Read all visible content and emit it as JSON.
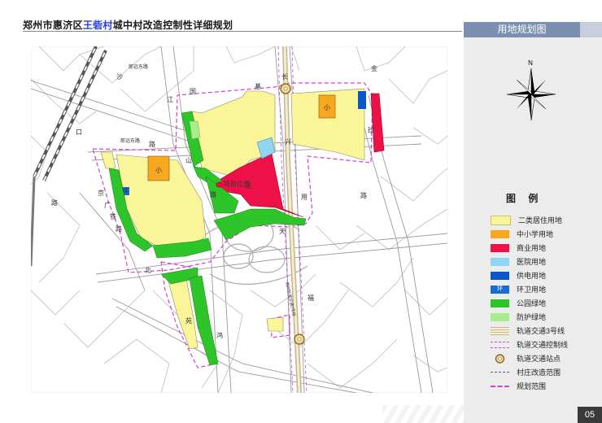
{
  "header": {
    "title_prefix": "郑州市惠济区",
    "title_highlight": "王砦村",
    "title_suffix": "城中村改造控制性详细规划",
    "panel_tab": "用地规划图",
    "page_number": "05"
  },
  "compass": {
    "north_label": "N"
  },
  "legend": {
    "title": "图 例",
    "items": [
      {
        "label": "二类居住用地",
        "color": "#fbf59a",
        "kind": "fill"
      },
      {
        "label": "中小学用地",
        "color": "#f7a81f",
        "kind": "fill"
      },
      {
        "label": "商业用地",
        "color": "#ee1148",
        "kind": "fill"
      },
      {
        "label": "医院用地",
        "color": "#8fd6f3",
        "kind": "fill"
      },
      {
        "label": "供电用地",
        "color": "#0b57c8",
        "kind": "fill"
      },
      {
        "label": "环卫用地",
        "color": "#1a6bd6",
        "kind": "fill-text",
        "text": "环"
      },
      {
        "label": "公园绿地",
        "color": "#2ec52a",
        "kind": "fill"
      },
      {
        "label": "防护绿地",
        "color": "#a6ee8c",
        "kind": "fill"
      },
      {
        "label": "轨道交通3号线",
        "color": "#c8b48a",
        "kind": "rail"
      },
      {
        "label": "轨道交通控制线",
        "color": "#c24fd0",
        "kind": "double-dash"
      },
      {
        "label": "轨道交通站点",
        "color": "#c8a23a",
        "kind": "station"
      },
      {
        "label": "村庄改造范围",
        "color": "#5a5aa8",
        "kind": "dash-thin"
      },
      {
        "label": "规划范围",
        "color": "#d43fd0",
        "kind": "dash"
      }
    ]
  },
  "map": {
    "labels": {
      "school_1": "小",
      "school_2": "小",
      "sanitation": "环",
      "project_location": "项目位置",
      "road_youyuan": "郎远东路",
      "road_youyuan_north": "郎远东路",
      "road_xing": "兴",
      "road_sha": "沙",
      "road_guo": "国",
      "road_ji": "基",
      "road_chang": "长",
      "road_jiang": "江",
      "road_kou": "口",
      "road_jin": "金",
      "road_lu_1": "路",
      "road_lu_2": "路",
      "road_lu_3": "路",
      "road_lu_4": "路",
      "road_lu_5": "路",
      "road_jing": "京",
      "road_guang": "广",
      "road_tie": "铁",
      "road_bei": "北",
      "road_shan": "山",
      "road_wang": "王",
      "road_yong": "用",
      "road_xiang": "珍",
      "road_tian": "天",
      "road_fu": "福",
      "road_hong": "鸿",
      "road_yuan": "苑",
      "road_line": "郑州轨道交通3号线"
    }
  }
}
